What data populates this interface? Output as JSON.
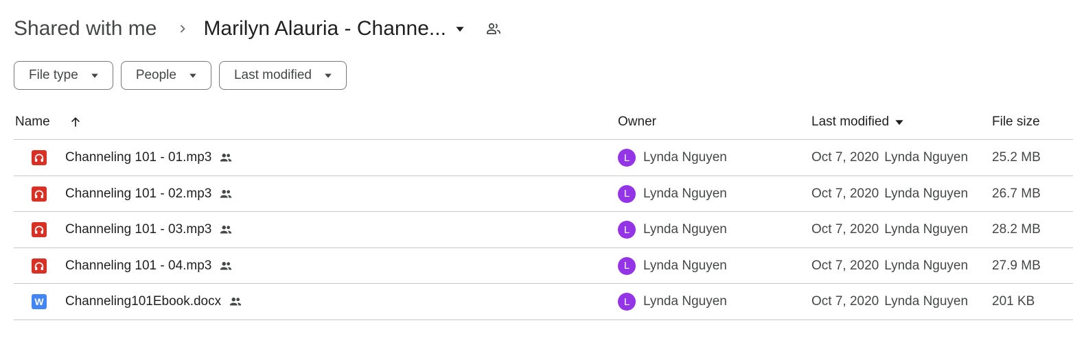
{
  "breadcrumb": {
    "root": "Shared with me",
    "current": "Marilyn Alauria - Channe..."
  },
  "icons": {
    "breadcrumb_separator": "chevron-right-icon",
    "folder_menu": "caret-down-icon",
    "folder_shared": "people-outline-icon",
    "file_shared": "people-icon",
    "sort": "arrow-up-icon"
  },
  "filters": [
    {
      "label": "File type"
    },
    {
      "label": "People"
    },
    {
      "label": "Last modified"
    }
  ],
  "table": {
    "headers": {
      "name": "Name",
      "owner": "Owner",
      "last_modified": "Last modified",
      "file_size": "File size"
    },
    "rows": [
      {
        "name": "Channeling 101 - 01.mp3",
        "type": "audio",
        "owner": "Lynda Nguyen",
        "owner_initial": "L",
        "modified_date": "Oct 7, 2020",
        "modified_by": "Lynda Nguyen",
        "size": "25.2 MB"
      },
      {
        "name": "Channeling 101 - 02.mp3",
        "type": "audio",
        "owner": "Lynda Nguyen",
        "owner_initial": "L",
        "modified_date": "Oct 7, 2020",
        "modified_by": "Lynda Nguyen",
        "size": "26.7 MB"
      },
      {
        "name": "Channeling 101 - 03.mp3",
        "type": "audio",
        "owner": "Lynda Nguyen",
        "owner_initial": "L",
        "modified_date": "Oct 7, 2020",
        "modified_by": "Lynda Nguyen",
        "size": "28.2 MB"
      },
      {
        "name": "Channeling 101 - 04.mp3",
        "type": "audio",
        "owner": "Lynda Nguyen",
        "owner_initial": "L",
        "modified_date": "Oct 7, 2020",
        "modified_by": "Lynda Nguyen",
        "size": "27.9 MB"
      },
      {
        "name": "Channeling101Ebook.docx",
        "type": "word",
        "type_letter": "W",
        "owner": "Lynda Nguyen",
        "owner_initial": "L",
        "modified_date": "Oct 7, 2020",
        "modified_by": "Lynda Nguyen",
        "size": "201 KB"
      }
    ]
  },
  "colors": {
    "audio_icon": "#d93025",
    "word_icon": "#4285f4",
    "avatar": "#9334e6",
    "divider": "#c7c7c7"
  }
}
